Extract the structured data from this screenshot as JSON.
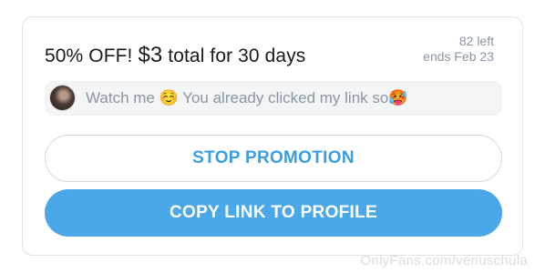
{
  "promo": {
    "title_prefix": "50% OFF! ",
    "price": "$3",
    "title_suffix": " total for 30 days",
    "remaining": "82 left",
    "ends": "ends Feb 23"
  },
  "message": {
    "text": "Watch me ☺️ You already clicked my link so🥵"
  },
  "buttons": {
    "stop_label": "STOP PROMOTION",
    "copy_label": "COPY LINK TO PROFILE"
  },
  "watermark": "OnlyFans.com/venuschula",
  "colors": {
    "accent": "#3a9fe0",
    "primary_button": "#4aa8e8",
    "muted_text": "#8a96a3"
  }
}
